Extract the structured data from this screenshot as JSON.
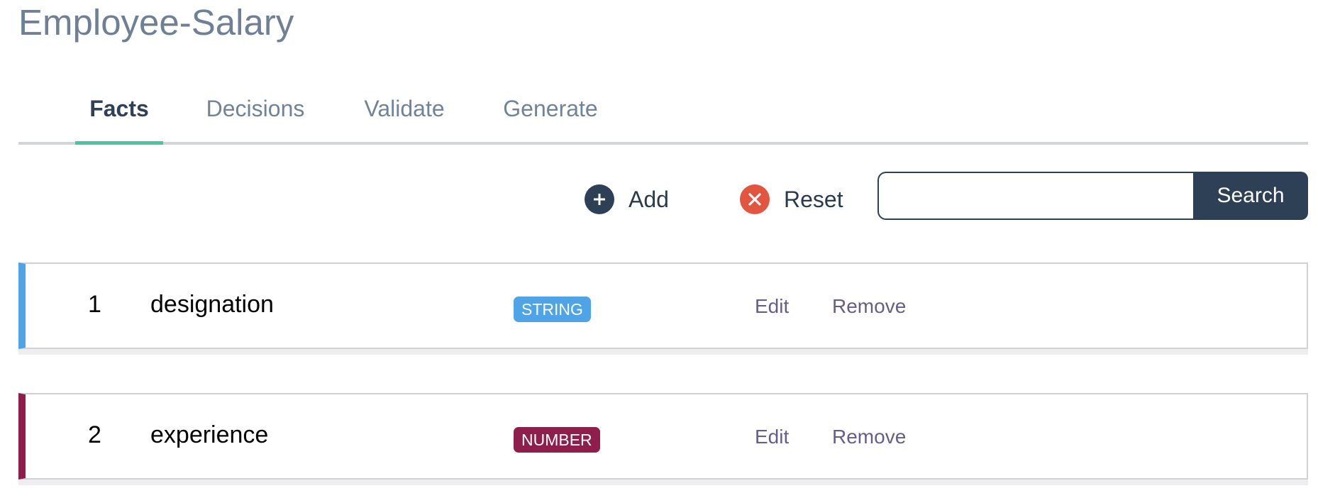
{
  "page": {
    "title": "Employee-Salary"
  },
  "tabs": [
    {
      "label": "Facts",
      "active": true
    },
    {
      "label": "Decisions",
      "active": false
    },
    {
      "label": "Validate",
      "active": false
    },
    {
      "label": "Generate",
      "active": false
    }
  ],
  "toolbar": {
    "add_label": "Add",
    "add_icon": "plus-circle-icon",
    "reset_label": "Reset",
    "reset_icon": "x-circle-icon",
    "search_value": "",
    "search_button_label": "Search"
  },
  "facts": [
    {
      "index": "1",
      "name": "designation",
      "type": "STRING",
      "type_color": "#4ea4e6",
      "edit_label": "Edit",
      "remove_label": "Remove"
    },
    {
      "index": "2",
      "name": "experience",
      "type": "NUMBER",
      "type_color": "#8e1f4d",
      "edit_label": "Edit",
      "remove_label": "Remove"
    }
  ],
  "colors": {
    "title": "#6f7f95",
    "active_tab_underline": "#4cc3a1",
    "primary_dark": "#2e4055",
    "reset_red": "#e2553e",
    "link_purple": "#675d8c"
  }
}
